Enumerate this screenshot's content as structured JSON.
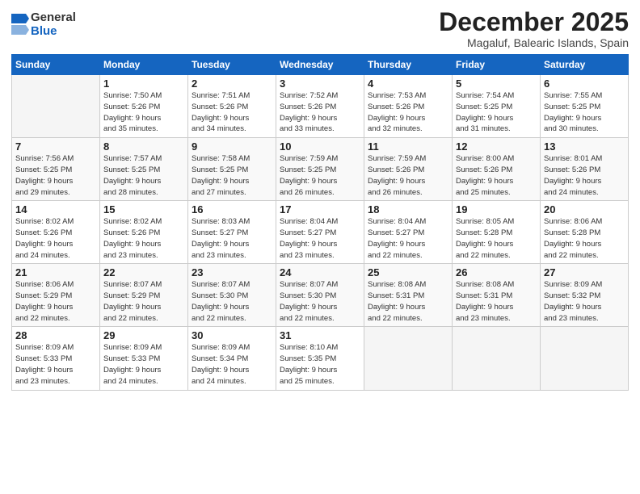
{
  "logo": {
    "general": "General",
    "blue": "Blue"
  },
  "title": "December 2025",
  "location": "Magaluf, Balearic Islands, Spain",
  "weekdays": [
    "Sunday",
    "Monday",
    "Tuesday",
    "Wednesday",
    "Thursday",
    "Friday",
    "Saturday"
  ],
  "weeks": [
    [
      {
        "day": "",
        "info": ""
      },
      {
        "day": "1",
        "info": "Sunrise: 7:50 AM\nSunset: 5:26 PM\nDaylight: 9 hours\nand 35 minutes."
      },
      {
        "day": "2",
        "info": "Sunrise: 7:51 AM\nSunset: 5:26 PM\nDaylight: 9 hours\nand 34 minutes."
      },
      {
        "day": "3",
        "info": "Sunrise: 7:52 AM\nSunset: 5:26 PM\nDaylight: 9 hours\nand 33 minutes."
      },
      {
        "day": "4",
        "info": "Sunrise: 7:53 AM\nSunset: 5:26 PM\nDaylight: 9 hours\nand 32 minutes."
      },
      {
        "day": "5",
        "info": "Sunrise: 7:54 AM\nSunset: 5:25 PM\nDaylight: 9 hours\nand 31 minutes."
      },
      {
        "day": "6",
        "info": "Sunrise: 7:55 AM\nSunset: 5:25 PM\nDaylight: 9 hours\nand 30 minutes."
      }
    ],
    [
      {
        "day": "7",
        "info": "Sunrise: 7:56 AM\nSunset: 5:25 PM\nDaylight: 9 hours\nand 29 minutes."
      },
      {
        "day": "8",
        "info": "Sunrise: 7:57 AM\nSunset: 5:25 PM\nDaylight: 9 hours\nand 28 minutes."
      },
      {
        "day": "9",
        "info": "Sunrise: 7:58 AM\nSunset: 5:25 PM\nDaylight: 9 hours\nand 27 minutes."
      },
      {
        "day": "10",
        "info": "Sunrise: 7:59 AM\nSunset: 5:25 PM\nDaylight: 9 hours\nand 26 minutes."
      },
      {
        "day": "11",
        "info": "Sunrise: 7:59 AM\nSunset: 5:26 PM\nDaylight: 9 hours\nand 26 minutes."
      },
      {
        "day": "12",
        "info": "Sunrise: 8:00 AM\nSunset: 5:26 PM\nDaylight: 9 hours\nand 25 minutes."
      },
      {
        "day": "13",
        "info": "Sunrise: 8:01 AM\nSunset: 5:26 PM\nDaylight: 9 hours\nand 24 minutes."
      }
    ],
    [
      {
        "day": "14",
        "info": "Sunrise: 8:02 AM\nSunset: 5:26 PM\nDaylight: 9 hours\nand 24 minutes."
      },
      {
        "day": "15",
        "info": "Sunrise: 8:02 AM\nSunset: 5:26 PM\nDaylight: 9 hours\nand 23 minutes."
      },
      {
        "day": "16",
        "info": "Sunrise: 8:03 AM\nSunset: 5:27 PM\nDaylight: 9 hours\nand 23 minutes."
      },
      {
        "day": "17",
        "info": "Sunrise: 8:04 AM\nSunset: 5:27 PM\nDaylight: 9 hours\nand 23 minutes."
      },
      {
        "day": "18",
        "info": "Sunrise: 8:04 AM\nSunset: 5:27 PM\nDaylight: 9 hours\nand 22 minutes."
      },
      {
        "day": "19",
        "info": "Sunrise: 8:05 AM\nSunset: 5:28 PM\nDaylight: 9 hours\nand 22 minutes."
      },
      {
        "day": "20",
        "info": "Sunrise: 8:06 AM\nSunset: 5:28 PM\nDaylight: 9 hours\nand 22 minutes."
      }
    ],
    [
      {
        "day": "21",
        "info": "Sunrise: 8:06 AM\nSunset: 5:29 PM\nDaylight: 9 hours\nand 22 minutes."
      },
      {
        "day": "22",
        "info": "Sunrise: 8:07 AM\nSunset: 5:29 PM\nDaylight: 9 hours\nand 22 minutes."
      },
      {
        "day": "23",
        "info": "Sunrise: 8:07 AM\nSunset: 5:30 PM\nDaylight: 9 hours\nand 22 minutes."
      },
      {
        "day": "24",
        "info": "Sunrise: 8:07 AM\nSunset: 5:30 PM\nDaylight: 9 hours\nand 22 minutes."
      },
      {
        "day": "25",
        "info": "Sunrise: 8:08 AM\nSunset: 5:31 PM\nDaylight: 9 hours\nand 22 minutes."
      },
      {
        "day": "26",
        "info": "Sunrise: 8:08 AM\nSunset: 5:31 PM\nDaylight: 9 hours\nand 23 minutes."
      },
      {
        "day": "27",
        "info": "Sunrise: 8:09 AM\nSunset: 5:32 PM\nDaylight: 9 hours\nand 23 minutes."
      }
    ],
    [
      {
        "day": "28",
        "info": "Sunrise: 8:09 AM\nSunset: 5:33 PM\nDaylight: 9 hours\nand 23 minutes."
      },
      {
        "day": "29",
        "info": "Sunrise: 8:09 AM\nSunset: 5:33 PM\nDaylight: 9 hours\nand 24 minutes."
      },
      {
        "day": "30",
        "info": "Sunrise: 8:09 AM\nSunset: 5:34 PM\nDaylight: 9 hours\nand 24 minutes."
      },
      {
        "day": "31",
        "info": "Sunrise: 8:10 AM\nSunset: 5:35 PM\nDaylight: 9 hours\nand 25 minutes."
      },
      {
        "day": "",
        "info": ""
      },
      {
        "day": "",
        "info": ""
      },
      {
        "day": "",
        "info": ""
      }
    ]
  ]
}
